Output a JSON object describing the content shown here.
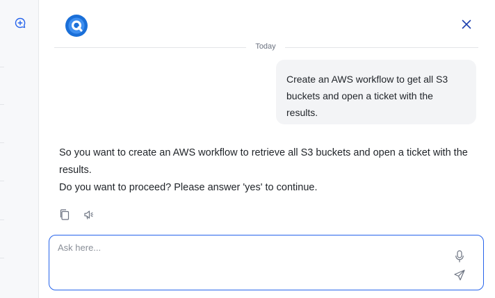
{
  "icons": {
    "new_chat": "chat-plus-icon",
    "logo": "assistant-logo-icon",
    "close": "close-icon",
    "copy": "copy-icon",
    "speak": "speaker-icon",
    "mic": "microphone-icon",
    "send": "send-icon"
  },
  "colors": {
    "accent": "#2563eb",
    "bubble_bg": "#f3f4f6",
    "rail_bg": "#f7f8fa"
  },
  "conversation": {
    "date_separator": "Today",
    "user_message": "Create an AWS workflow to get all S3 buckets and open a ticket with the results.",
    "bot_message": {
      "line1": "So you want to create an AWS workflow to retrieve all S3 buckets and open a ticket with the results.",
      "line2": "Do you want to proceed? Please answer 'yes' to continue."
    }
  },
  "composer": {
    "placeholder": "Ask here...",
    "value": ""
  }
}
